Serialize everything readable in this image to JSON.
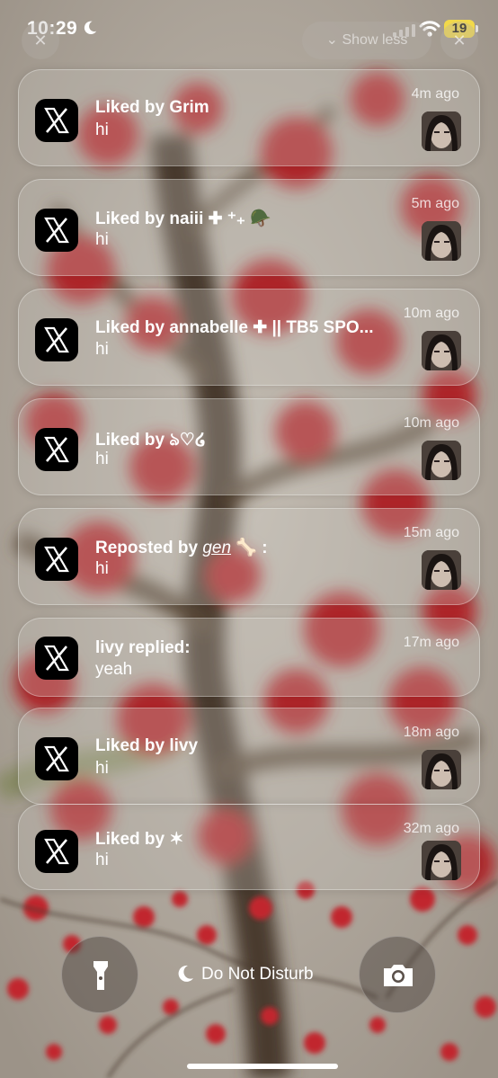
{
  "status_bar": {
    "time": "10:29",
    "battery": "19",
    "focus_icon": "moon-icon"
  },
  "stack_controls": {
    "show_less_label": "Show less"
  },
  "notifications": [
    {
      "app": "X",
      "title": "Liked by Grim",
      "body": "hi",
      "time": "4m ago"
    },
    {
      "app": "X",
      "title": "Liked by naiii ✚ ⁺₊ 🪖",
      "body": "hi",
      "time": "5m ago"
    },
    {
      "app": "X",
      "title": "Liked by annabelle ✚ || TB5 SPO...",
      "body": "hi",
      "time": "10m ago"
    },
    {
      "app": "X",
      "title": "Liked by ঌ♡໒",
      "body": "hi",
      "time": "10m ago"
    },
    {
      "app": "X",
      "title_prefix": "Reposted by ",
      "title_name": "gen",
      "title_suffix": " 🦴 :",
      "body": "hi",
      "time": "15m ago"
    },
    {
      "app": "X",
      "title": "livy replied:",
      "body": "yeah",
      "time": "17m ago"
    },
    {
      "app": "X",
      "title": "Liked by livy",
      "body": "hi",
      "time": "18m ago"
    },
    {
      "app": "X",
      "title": "Liked by ✶",
      "body": "hi",
      "time": "32m ago"
    }
  ],
  "lock_bottom": {
    "focus_label": "Do Not Disturb",
    "left_button_icon": "flashlight-icon",
    "right_button_icon": "camera-icon"
  }
}
